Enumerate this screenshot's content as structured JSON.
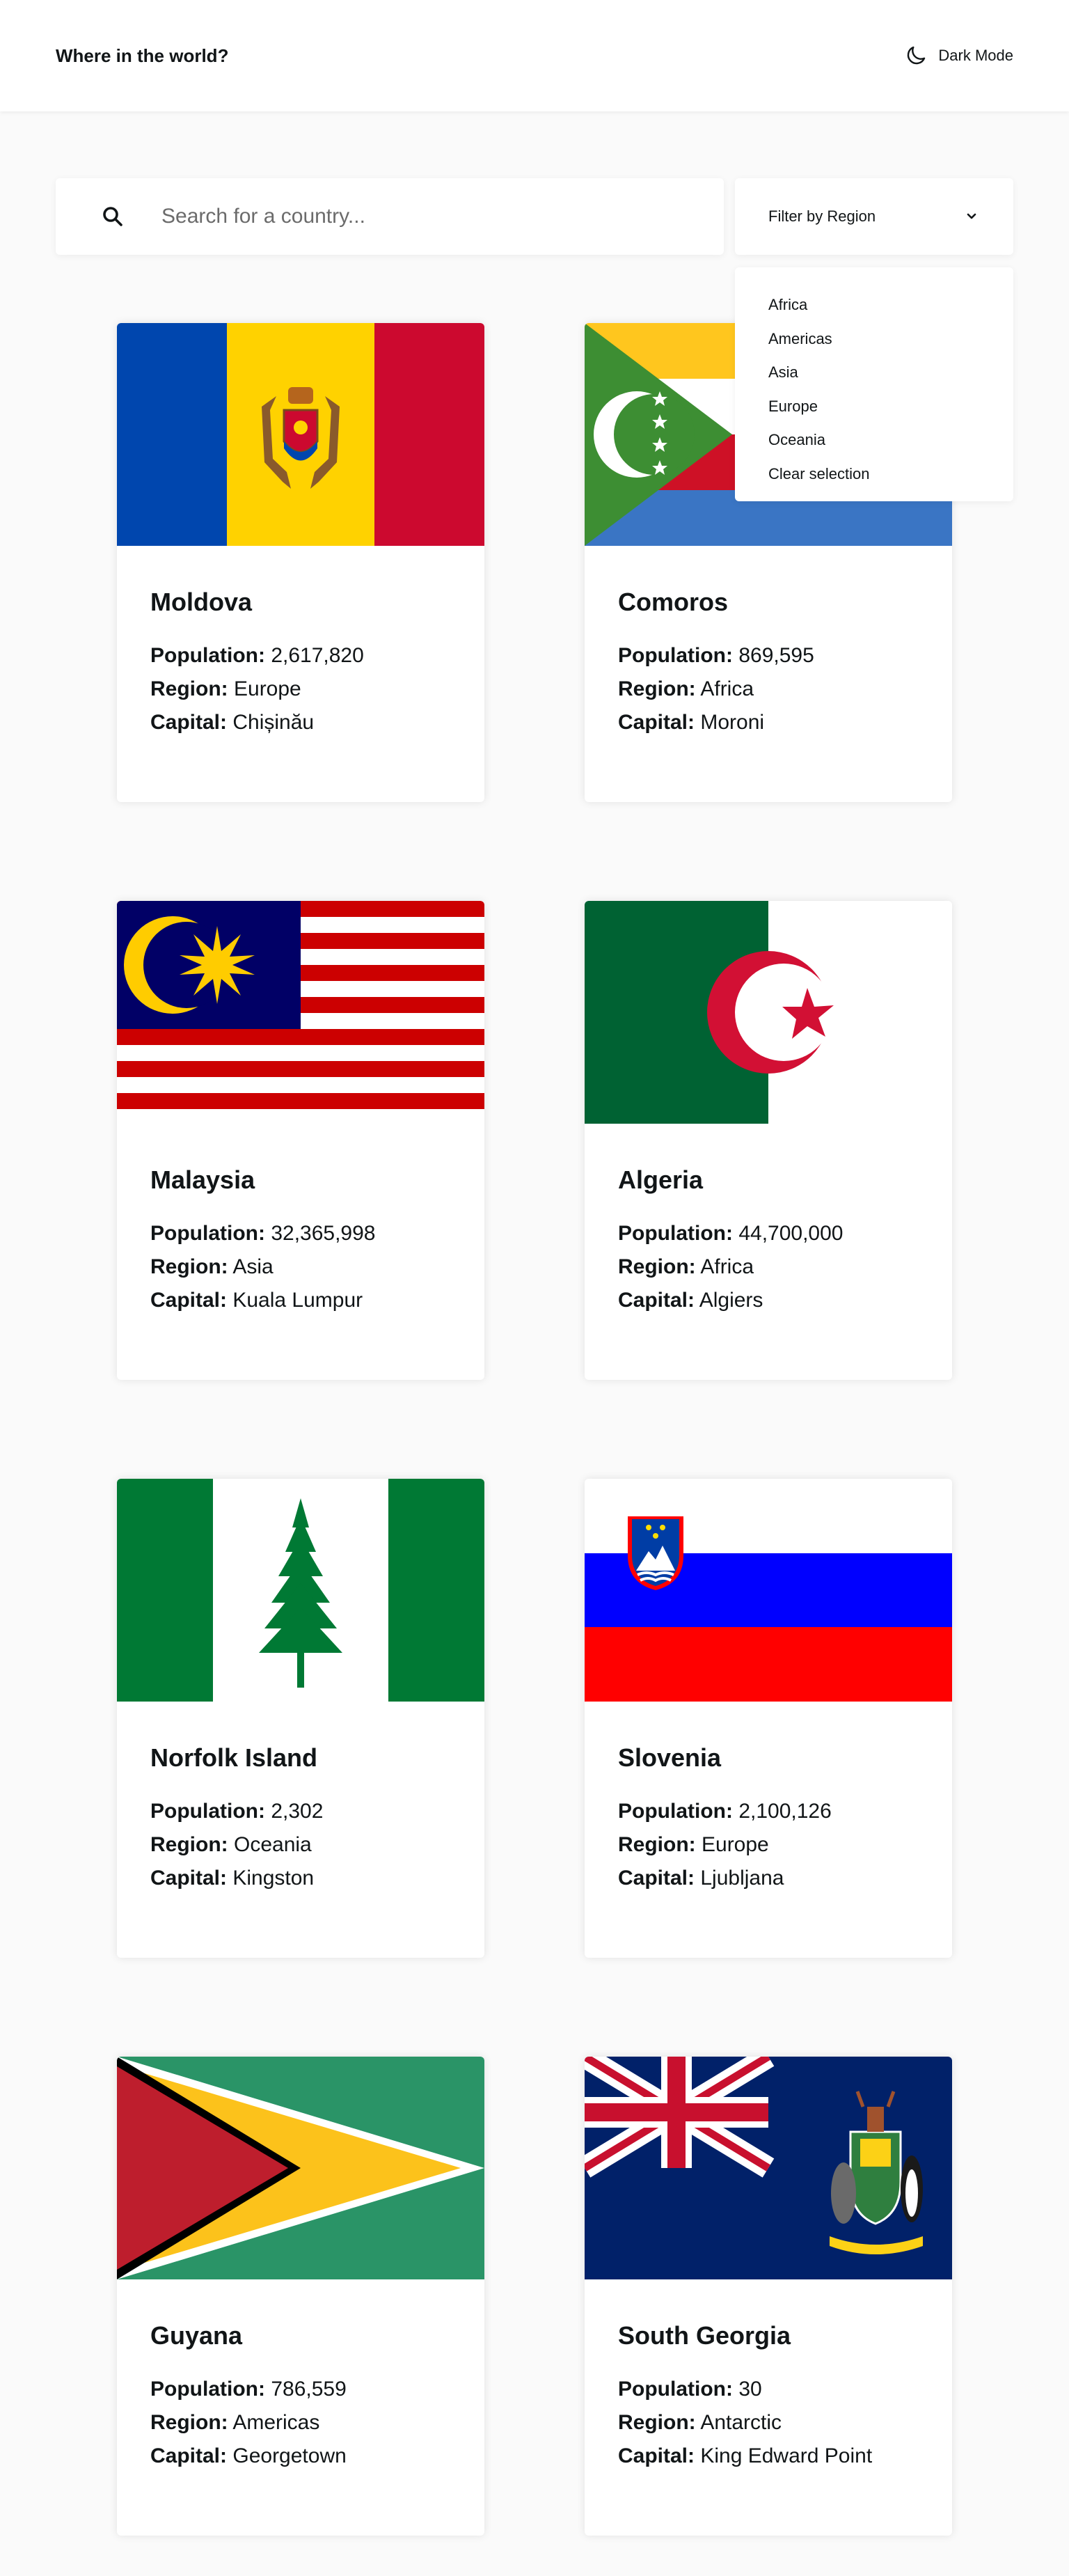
{
  "header": {
    "title": "Where in the world?",
    "dark_mode_label": "Dark Mode"
  },
  "search": {
    "placeholder": "Search for a country...",
    "value": ""
  },
  "filter": {
    "label": "Filter by Region",
    "options": [
      "Africa",
      "Americas",
      "Asia",
      "Europe",
      "Oceania",
      "Clear selection"
    ]
  },
  "labels": {
    "population": "Population:",
    "region": "Region:",
    "capital": "Capital:"
  },
  "countries": [
    {
      "name": "Moldova",
      "population": "2,617,820",
      "region": "Europe",
      "capital": "Chișinău"
    },
    {
      "name": "Comoros",
      "population": "869,595",
      "region": "Africa",
      "capital": "Moroni"
    },
    {
      "name": "Malaysia",
      "population": "32,365,998",
      "region": "Asia",
      "capital": "Kuala Lumpur"
    },
    {
      "name": "Algeria",
      "population": "44,700,000",
      "region": "Africa",
      "capital": "Algiers"
    },
    {
      "name": "Norfolk Island",
      "population": "2,302",
      "region": "Oceania",
      "capital": "Kingston"
    },
    {
      "name": "Slovenia",
      "population": "2,100,126",
      "region": "Europe",
      "capital": "Ljubljana"
    },
    {
      "name": "Guyana",
      "population": "786,559",
      "region": "Americas",
      "capital": "Georgetown"
    },
    {
      "name": "South Georgia",
      "population": "30",
      "region": "Antarctic",
      "capital": "King Edward Point"
    }
  ],
  "icons": {
    "dark_mode": "moon-icon",
    "search": "search-icon",
    "filter": "chevron-down-icon"
  },
  "colors": {
    "background": "#fafafa",
    "surface": "#ffffff",
    "text": "#111517"
  }
}
